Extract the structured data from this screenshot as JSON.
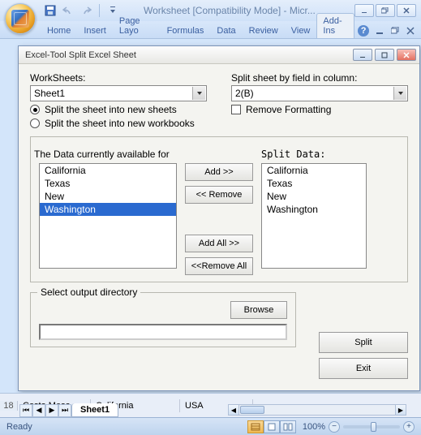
{
  "titlebar": {
    "title": "Worksheet  [Compatibility Mode] - Micr..."
  },
  "ribbon": {
    "tabs": [
      "Home",
      "Insert",
      "Page Layo",
      "Formulas",
      "Data",
      "Review",
      "View",
      "Add-Ins"
    ]
  },
  "dialog": {
    "title": "Excel-Tool Split Excel Sheet",
    "worksheets_label": "WorkSheets:",
    "worksheet_value": "Sheet1",
    "splitcol_label": "Split sheet by field in column:",
    "splitcol_value": "2(B)",
    "radio_sheets": "Split the sheet into new sheets",
    "radio_workbooks": "Split the sheet into new workbooks",
    "remove_formatting": "Remove Formatting",
    "available_label": "The Data currently available for",
    "splitdata_label": "Split Data:",
    "available_items": [
      "California",
      "Texas",
      "New",
      "Washington"
    ],
    "split_items": [
      "California",
      "Texas",
      "New",
      "Washington"
    ],
    "btn_add": "Add >>",
    "btn_remove": "<< Remove",
    "btn_addall": "Add All >>",
    "btn_removeall": "<<Remove All",
    "output_legend": "Select output directory",
    "btn_browse": "Browse",
    "btn_split": "Split",
    "btn_exit": "Exit"
  },
  "sheet": {
    "row_num": "18",
    "cells": [
      "Costa Mesa",
      "California",
      "USA"
    ],
    "tab": "Sheet1"
  },
  "status": {
    "ready": "Ready",
    "zoom": "100%"
  }
}
